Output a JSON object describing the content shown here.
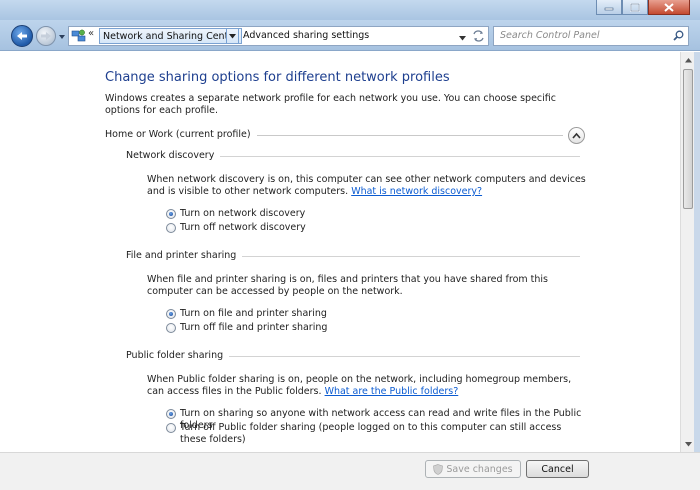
{
  "nav": {
    "recent_pages_label": "«",
    "breadcrumbs": [
      "Network and Sharing Center",
      "Advanced sharing settings"
    ]
  },
  "search": {
    "placeholder": "Search Control Panel"
  },
  "main": {
    "title": "Change sharing options for different network profiles",
    "intro": "Windows creates a separate network profile for each network you use. You can choose specific options for each profile.",
    "profile": {
      "label": "Home or Work (current profile)",
      "expanded": true
    },
    "sections": [
      {
        "heading": "Network discovery",
        "description": "When network discovery is on, this computer can see other network computers and devices and is visible to other network computers.",
        "link": "What is network discovery?",
        "options": [
          {
            "label": "Turn on network discovery",
            "selected": true
          },
          {
            "label": "Turn off network discovery",
            "selected": false
          }
        ]
      },
      {
        "heading": "File and printer sharing",
        "description": "When file and printer sharing is on, files and printers that you have shared from this computer can be accessed by people on the network.",
        "options": [
          {
            "label": "Turn on file and printer sharing",
            "selected": true
          },
          {
            "label": "Turn off file and printer sharing",
            "selected": false
          }
        ]
      },
      {
        "heading": "Public folder sharing",
        "description": "When Public folder sharing is on, people on the network, including homegroup members, can access files in the Public folders.",
        "link": "What are the Public folders?",
        "options": [
          {
            "label": "Turn on sharing so anyone with network access can read and write files in the Public folders",
            "selected": true
          },
          {
            "label": "Turn off Public folder sharing (people logged on to this computer can still access these folders)",
            "selected": false
          }
        ]
      }
    ]
  },
  "footer": {
    "save_label": "Save changes",
    "save_enabled": false,
    "cancel_label": "Cancel"
  },
  "colors": {
    "title_blue": "#1e3f8f",
    "link_blue": "#0b5bd1",
    "chrome_blue": "#a9c5e2"
  },
  "icons": [
    "minimize-icon",
    "maximize-icon",
    "close-icon",
    "back-arrow-icon",
    "forward-arrow-icon",
    "recent-pages-icon",
    "network-icon",
    "dropdown-icon",
    "refresh-icon",
    "search-icon",
    "collapse-icon",
    "uac-shield-icon"
  ]
}
